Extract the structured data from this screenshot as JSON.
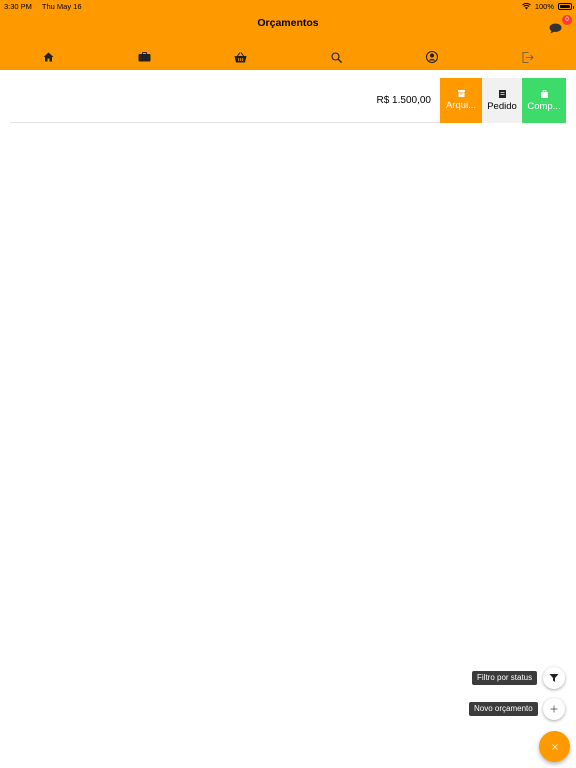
{
  "status_bar": {
    "time": "3:30 PM",
    "date": "Thu May 16",
    "battery": "100%"
  },
  "header": {
    "title": "Orçamentos",
    "chat_badge": "0"
  },
  "tabs": [
    {
      "icon": "home-icon"
    },
    {
      "icon": "briefcase-icon"
    },
    {
      "icon": "basket-icon"
    },
    {
      "icon": "search-icon"
    },
    {
      "icon": "user-circle-icon"
    },
    {
      "icon": "logout-icon"
    }
  ],
  "quote_row": {
    "amount": "R$ 1.500,00",
    "actions": [
      {
        "label": "Arqui...",
        "color": "#ff9900",
        "icon": "archive-icon"
      },
      {
        "label": "Pedido",
        "color": "#f1f1f1",
        "icon": "order-icon"
      },
      {
        "label": "Comp...",
        "color": "#3ddc6a",
        "icon": "bag-icon"
      }
    ]
  },
  "fab": {
    "filter_tooltip": "Filtro por status",
    "new_tooltip": "Novo orçamento",
    "filter_icon": "filter-icon",
    "add_icon": "plus-icon",
    "close_icon": "close-icon",
    "accent": "#ff9900"
  }
}
